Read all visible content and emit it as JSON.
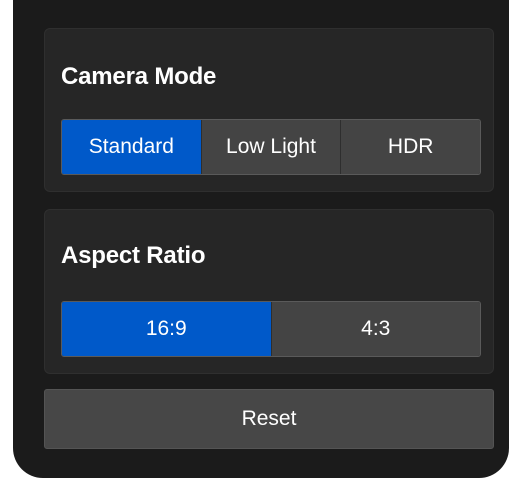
{
  "camera_mode": {
    "title": "Camera Mode",
    "options": [
      "Standard",
      "Low Light",
      "HDR"
    ],
    "selected": "Standard"
  },
  "aspect_ratio": {
    "title": "Aspect Ratio",
    "options": [
      "16:9",
      "4:3"
    ],
    "selected": "16:9"
  },
  "reset_label": "Reset",
  "colors": {
    "panel_bg": "#1b1b1b",
    "card_bg": "#262626",
    "active": "#0059c9",
    "inactive": "#444444"
  }
}
